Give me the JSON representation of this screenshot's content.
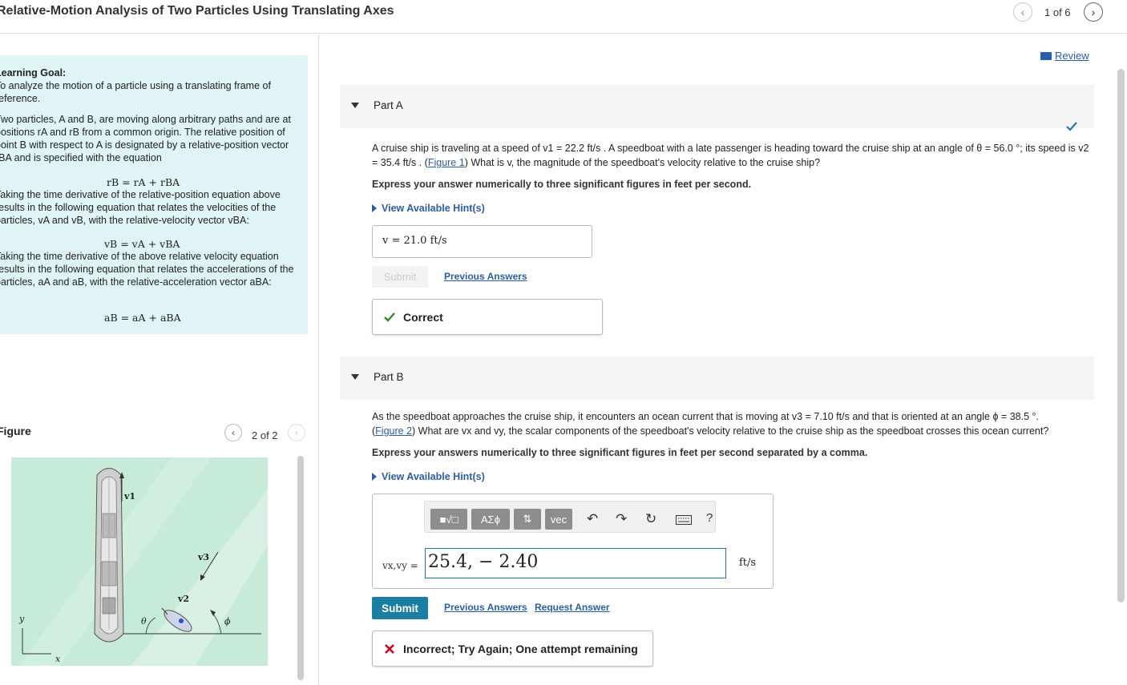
{
  "header": {
    "title": "Relative-Motion Analysis of Two Particles Using Translating Axes",
    "pager": "1 of 6",
    "prev_icon": "chevron-left-icon",
    "next_icon": "chevron-right-icon"
  },
  "left": {
    "goal_heading": "Learning Goal:",
    "goal_text": "To analyze the motion of a particle using a translating frame of reference.",
    "p1": "Two particles, A and B, are moving along arbitrary paths and are at positions rA and rB from a common origin. The relative position of point B with respect to A is designated by a relative-position vector rBA and is specified with the equation",
    "eq1": "rB = rA + rBA",
    "p2": "Taking the time derivative of the relative-position equation above results in the following equation that relates the velocities of the particles, vA and vB, with the relative-velocity vector vBA:",
    "eq2": "vB = vA + vBA",
    "p3": "Taking the time derivative of the above relative velocity equation results in the following equation that relates the accelerations of the particles, aA and aB, with the relative-acceleration vector aBA:",
    "eq3": "aB = aA + aBA",
    "figure_label": "Figure",
    "figure_pager": "2 of 2",
    "figure_labels": {
      "v1": "v1",
      "v2": "v2",
      "v3": "v3",
      "theta": "θ",
      "phi": "ϕ",
      "y": "y",
      "x": "x"
    }
  },
  "right": {
    "review_label": "Review",
    "partA": {
      "label": "Part A",
      "question_1": "A cruise ship is traveling at a speed of v1 = 22.2 ft/s . A speedboat with a late passenger is heading toward the cruise ship at an angle of θ = 56.0 °; its speed is v2 = 35.4 ft/s . (",
      "figure_link": "Figure 1",
      "question_2": ") What is v, the magnitude of the speedboat's velocity relative to the cruise ship?",
      "instruction": "Express your answer numerically to three significant figures in feet per second.",
      "hint": "View Available Hint(s)",
      "answer": "v =  21.0  ft/s",
      "submit_label": "Submit",
      "previous_answers": "Previous Answers",
      "feedback": "Correct"
    },
    "partB": {
      "label": "Part B",
      "question_1": "As the speedboat approaches the cruise ship, it encounters an ocean current that is moving at v3 = 7.10 ft/s and that is oriented at an angle ϕ = 38.5 °.",
      "figure_link": "Figure 2",
      "question_2": " What are vx and vy, the scalar components of the speedboat's velocity relative to the cruise ship as the speedboat crosses this ocean current?",
      "instruction": "Express your answers numerically to three significant figures in feet per second separated by a comma.",
      "hint": "View Available Hint(s)",
      "toolbar": {
        "greek": "ΑΣϕ",
        "vec": "vec",
        "help": "?"
      },
      "eq_label": "vx,vy =",
      "eq_value": "25.4, − 2.40",
      "unit": "ft/s",
      "submit_label": "Submit",
      "previous_answers": "Previous Answers",
      "request_answer": "Request Answer",
      "feedback": "Incorrect; Try Again; One attempt remaining"
    }
  },
  "colors": {
    "accent": "#1b7ea3",
    "link": "#2a5ea8",
    "goal_bg": "#e0f4f5",
    "correct": "#2e8b2e",
    "incorrect": "#d0021b"
  }
}
